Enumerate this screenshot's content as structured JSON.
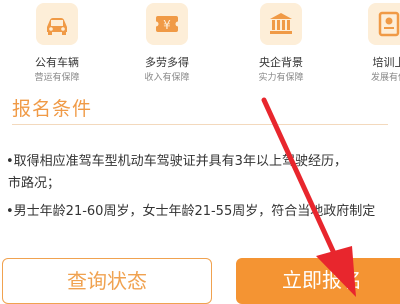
{
  "features": [
    {
      "title": "公有车辆",
      "subtitle": "营运有保障",
      "icon": "car-icon"
    },
    {
      "title": "多劳多得",
      "subtitle": "收入有保障",
      "icon": "yen-ticket-icon"
    },
    {
      "title": "央企背景",
      "subtitle": "实力有保障",
      "icon": "bank-building-icon"
    },
    {
      "title": "培训上",
      "subtitle": "发展有保",
      "icon": "certificate-icon"
    }
  ],
  "section": {
    "title": "报名条件"
  },
  "requirements": {
    "line1": "•取得相应准驾车型机动车驾驶证并具有3年以上驾驶经历，",
    "line2": "市路况；",
    "line3": "•男士年龄21-60周岁，女士年龄21-55周岁，符合当地政府制定"
  },
  "buttons": {
    "query": "查询状态",
    "signup": "立即报名"
  },
  "colors": {
    "accent": "#f49433",
    "arrow": "#e8262d",
    "icon": "#f09a46"
  }
}
